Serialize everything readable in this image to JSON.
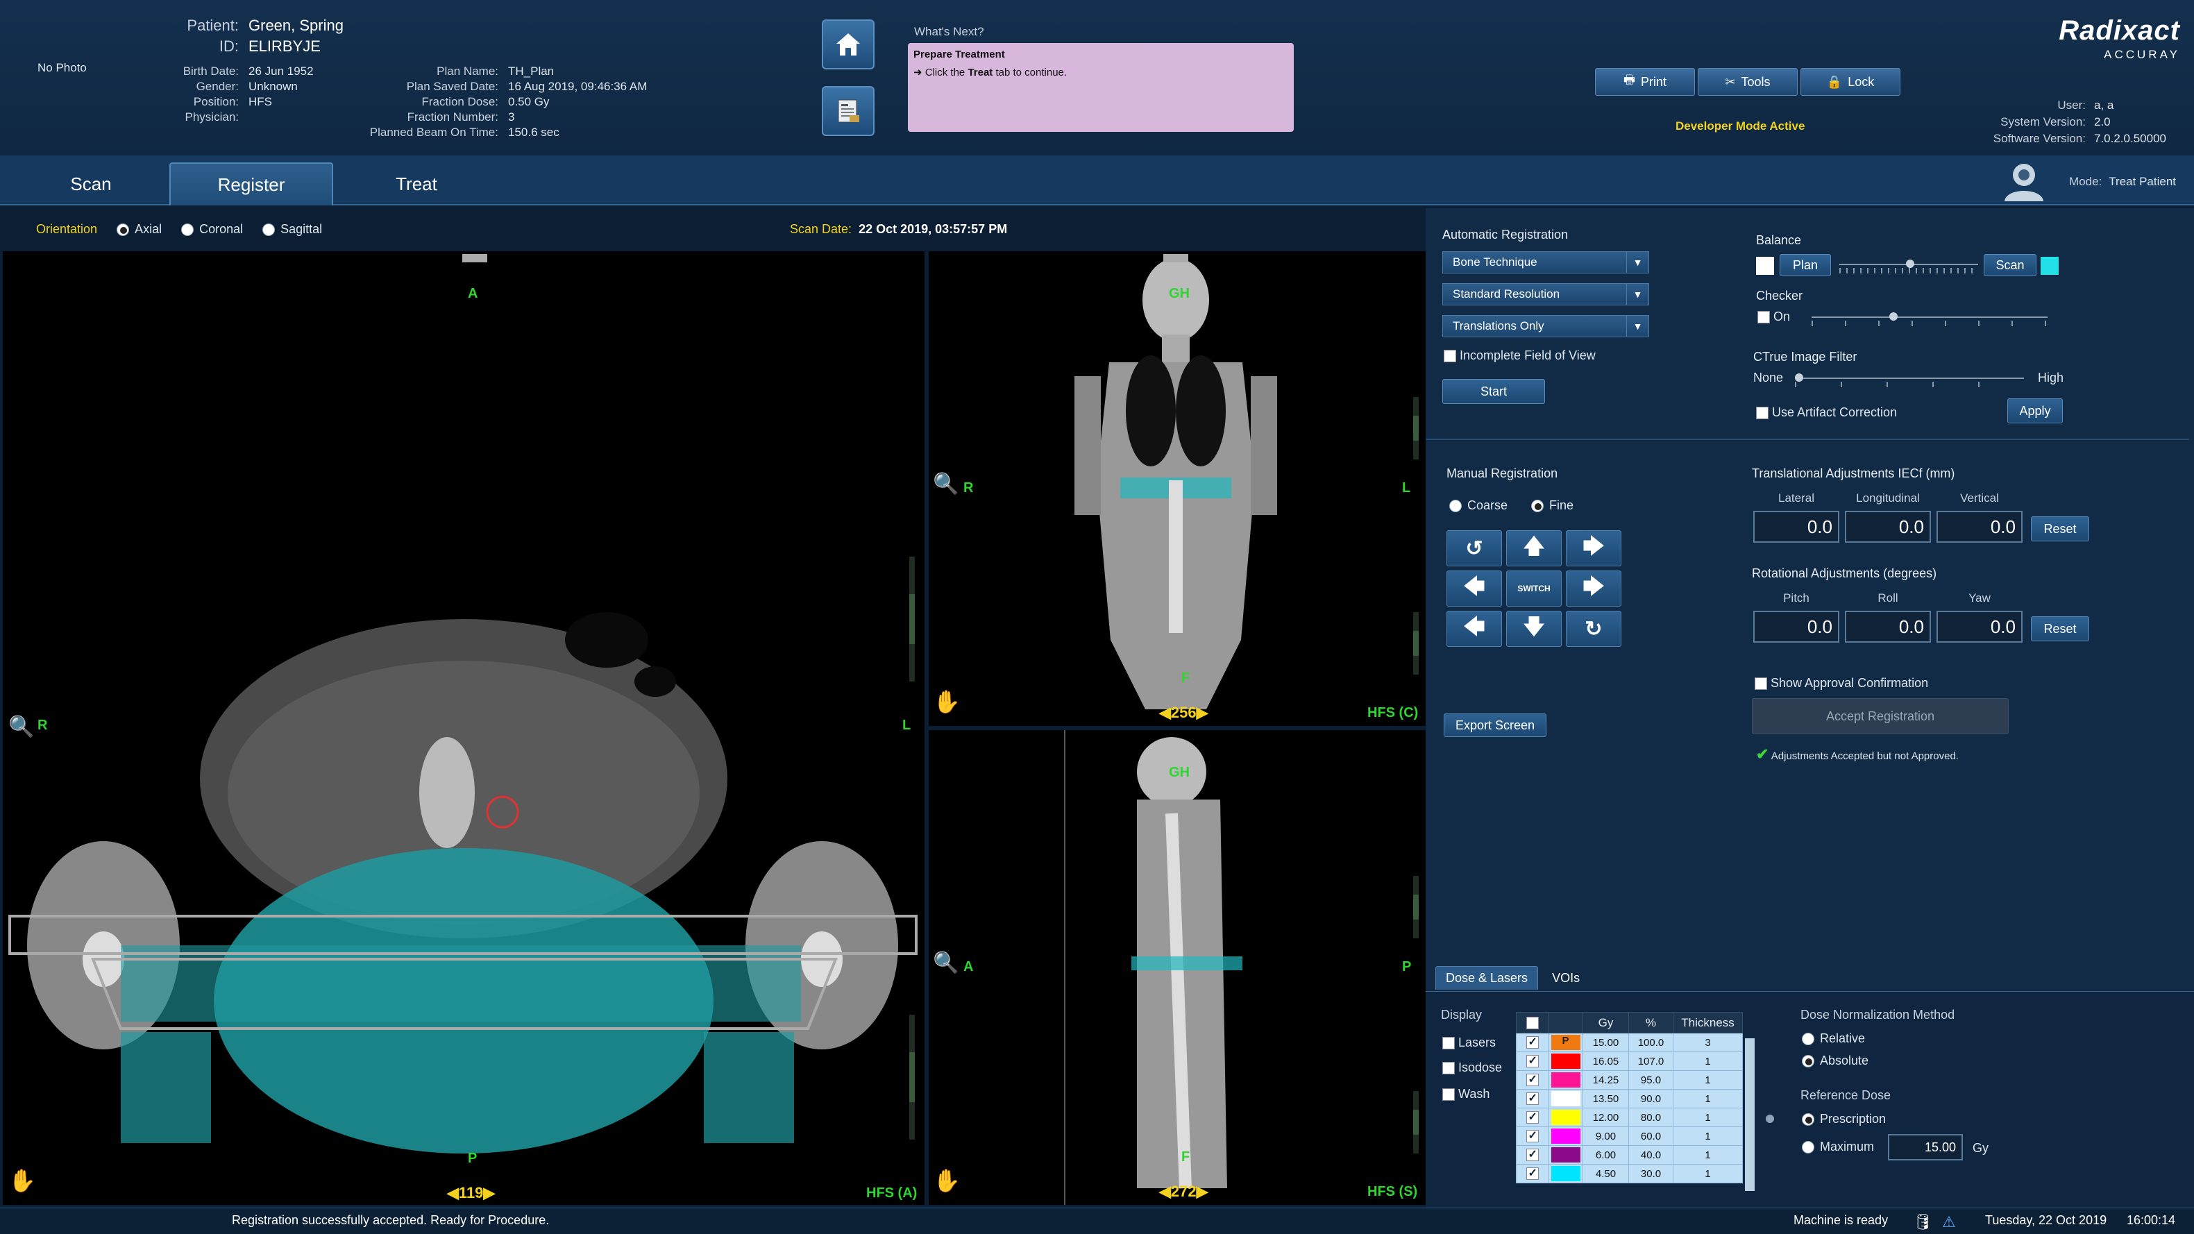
{
  "header": {
    "photo_placeholder": "No Photo",
    "patient_label": "Patient:",
    "patient_name": "Green, Spring",
    "id_label": "ID:",
    "id_value": "ELIRBYJE",
    "birth_label": "Birth Date:",
    "birth_value": "26 Jun 1952",
    "gender_label": "Gender:",
    "gender_value": "Unknown",
    "position_label": "Position:",
    "position_value": "HFS",
    "physician_label": "Physician:",
    "physician_value": "",
    "plan_name_label": "Plan Name:",
    "plan_name_value": "TH_Plan",
    "plan_saved_label": "Plan Saved Date:",
    "plan_saved_value": "16 Aug 2019, 09:46:36 AM",
    "fraction_dose_label": "Fraction Dose:",
    "fraction_dose_value": "0.50 Gy",
    "fraction_number_label": "Fraction Number:",
    "fraction_number_value": "3",
    "beam_time_label": "Planned Beam On Time:",
    "beam_time_value": "150.6 sec",
    "whats_next_label": "What's Next?",
    "whats_next_title": "Prepare Treatment",
    "whats_next_pre": "Click the",
    "whats_next_bold": "Treat",
    "whats_next_post": "tab to continue.",
    "print_label": "Print",
    "tools_label": "Tools",
    "lock_label": "Lock",
    "dev_mode": "Developer Mode Active",
    "logo_main": "Radixact",
    "logo_sub": "ACCURAY",
    "user_label": "User:",
    "user_value": "a, a",
    "sysver_label": "System Version:",
    "sysver_value": "2.0",
    "swver_label": "Software Version:",
    "swver_value": "7.0.2.0.50000",
    "icons": {
      "home": "home-icon",
      "plan": "plan-report-icon",
      "print": "printer-icon",
      "tools": "tools-icon",
      "lock": "lock-icon",
      "user": "user-icon"
    }
  },
  "tabs": {
    "scan": "Scan",
    "register": "Register",
    "treat": "Treat",
    "active": "Register"
  },
  "mode": {
    "label": "Mode:",
    "value": "Treat Patient"
  },
  "orientation": {
    "label": "Orientation",
    "options": [
      "Axial",
      "Coronal",
      "Sagittal"
    ],
    "selected": "Axial",
    "scan_date_label": "Scan Date:",
    "scan_date_value": "22 Oct 2019, 03:57:57 PM"
  },
  "viewers": {
    "axial": {
      "top": "A",
      "bottom": "P",
      "left": "R",
      "right": "L",
      "slice": "119",
      "tag": "HFS (A)"
    },
    "coronal": {
      "top": "GH",
      "bottom": "F",
      "left": "R",
      "right": "L",
      "slice": "256",
      "tag": "HFS (C)"
    },
    "sagittal": {
      "top": "GH",
      "bottom": "F",
      "left": "A",
      "right": "P",
      "slice": "272",
      "tag": "HFS (S)"
    }
  },
  "auto_reg": {
    "title": "Automatic Registration",
    "technique": "Bone Technique",
    "resolution": "Standard Resolution",
    "dof": "Translations Only",
    "incomplete_fov": "Incomplete Field of View",
    "start": "Start"
  },
  "balance": {
    "title": "Balance",
    "plan": "Plan",
    "scan": "Scan",
    "plan_color": "#ffffff",
    "scan_color": "#22e0e6",
    "checker_title": "Checker",
    "checker_on": "On",
    "filter_title": "CTrue Image Filter",
    "filter_none": "None",
    "filter_high": "High",
    "artifact": "Use Artifact Correction",
    "apply": "Apply"
  },
  "manual_reg": {
    "title": "Manual Registration",
    "coarse": "Coarse",
    "fine": "Fine",
    "selected": "Fine",
    "switch": "SWITCH"
  },
  "translational": {
    "title": "Translational Adjustments IECf (mm)",
    "cols": [
      "Lateral",
      "Longitudinal",
      "Vertical"
    ],
    "values": [
      "0.0",
      "0.0",
      "0.0"
    ],
    "reset": "Reset"
  },
  "rotational": {
    "title": "Rotational Adjustments (degrees)",
    "cols": [
      "Pitch",
      "Roll",
      "Yaw"
    ],
    "values": [
      "0.0",
      "0.0",
      "0.0"
    ],
    "reset": "Reset"
  },
  "approval": {
    "show": "Show Approval Confirmation",
    "accept": "Accept Registration",
    "status": "Adjustments Accepted but not Approved."
  },
  "export": "Export Screen",
  "dose_tabs": [
    "Dose & Lasers",
    "VOIs"
  ],
  "display": {
    "title": "Display",
    "lasers": "Lasers",
    "isodose": "Isodose",
    "wash": "Wash"
  },
  "dose_table": {
    "headers": [
      "Gy",
      "%",
      "Thickness"
    ],
    "rows": [
      {
        "color": "#f07a10",
        "mark": "P",
        "gy": "15.00",
        "pct": "100.0",
        "th": "3"
      },
      {
        "color": "#ff0000",
        "mark": "",
        "gy": "16.05",
        "pct": "107.0",
        "th": "1"
      },
      {
        "color": "#ff1493",
        "mark": "",
        "gy": "14.25",
        "pct": "95.0",
        "th": "1"
      },
      {
        "color": "#ffffff",
        "mark": "",
        "gy": "13.50",
        "pct": "90.0",
        "th": "1"
      },
      {
        "color": "#ffff00",
        "mark": "",
        "gy": "12.00",
        "pct": "80.0",
        "th": "1"
      },
      {
        "color": "#ff00ff",
        "mark": "",
        "gy": "9.00",
        "pct": "60.0",
        "th": "1"
      },
      {
        "color": "#8a0a8a",
        "mark": "",
        "gy": "6.00",
        "pct": "40.0",
        "th": "1"
      },
      {
        "color": "#00e5ff",
        "mark": "",
        "gy": "4.50",
        "pct": "30.0",
        "th": "1"
      }
    ]
  },
  "normalization": {
    "title": "Dose Normalization Method",
    "relative": "Relative",
    "absolute": "Absolute",
    "selected": "Absolute",
    "ref_title": "Reference Dose",
    "prescription": "Prescription",
    "maximum": "Maximum",
    "ref_selected": "Prescription",
    "max_value": "15.00",
    "unit": "Gy"
  },
  "status": {
    "message": "Registration successfully accepted. Ready for Procedure.",
    "machine": "Machine is ready",
    "date": "Tuesday, 22 Oct 2019",
    "time": "16:00:14"
  }
}
